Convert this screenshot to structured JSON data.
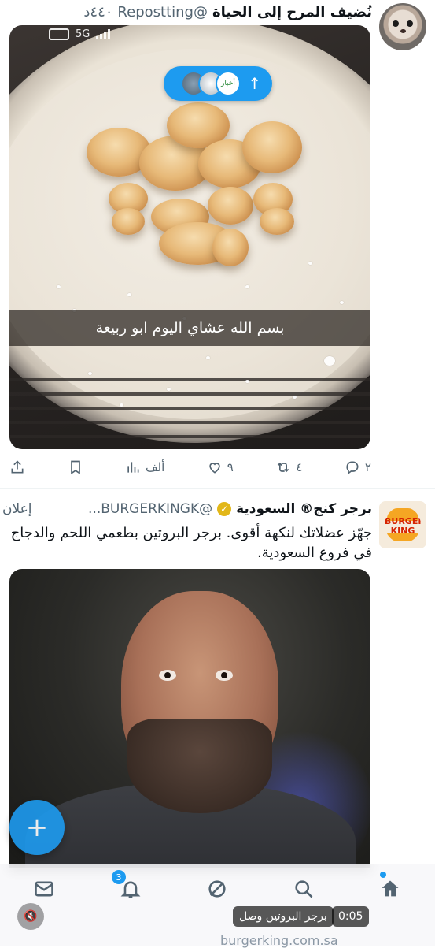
{
  "tweet1": {
    "display_name": "نُضيف المرح إلى الحياة",
    "handle": "@Repostting",
    "time": "٤٤٠د",
    "status_bar": {
      "network": "5G"
    },
    "new_posts_pill_icon": "arrow-up-icon",
    "pill_account_text": "أخبار",
    "caption": "بسم الله عشاي اليوم ابو ربيعة",
    "actions": {
      "replies": "٢",
      "reposts": "٤",
      "likes": "٩",
      "views": "ألف"
    }
  },
  "tweet2": {
    "display_name": "برجر كنج® السعودية",
    "handle": "@BURGERKINGK...",
    "ad_label": "إعلان",
    "text": "جهّز عضلاتك لنكهة أقوى. برجر البروتين بطعمي اللحم والدجاج في فروع السعودية.",
    "logo_text_top": "BURGER",
    "logo_text_bottom": "KING",
    "video_time": "0:05",
    "video_caption": "برجر البروتين وصل",
    "link_domain": "burgerking.com.sa"
  },
  "fab_icon": "plus-icon",
  "bottom_nav": {
    "notifications_badge": "3",
    "items": [
      "home-icon",
      "search-icon",
      "grok-icon",
      "notifications-icon",
      "messages-icon"
    ]
  },
  "colors": {
    "accent": "#1d9bf0",
    "text": "#0f1419",
    "muted": "#536471",
    "verified_gold": "#e2b719",
    "bk_red": "#d62300"
  }
}
